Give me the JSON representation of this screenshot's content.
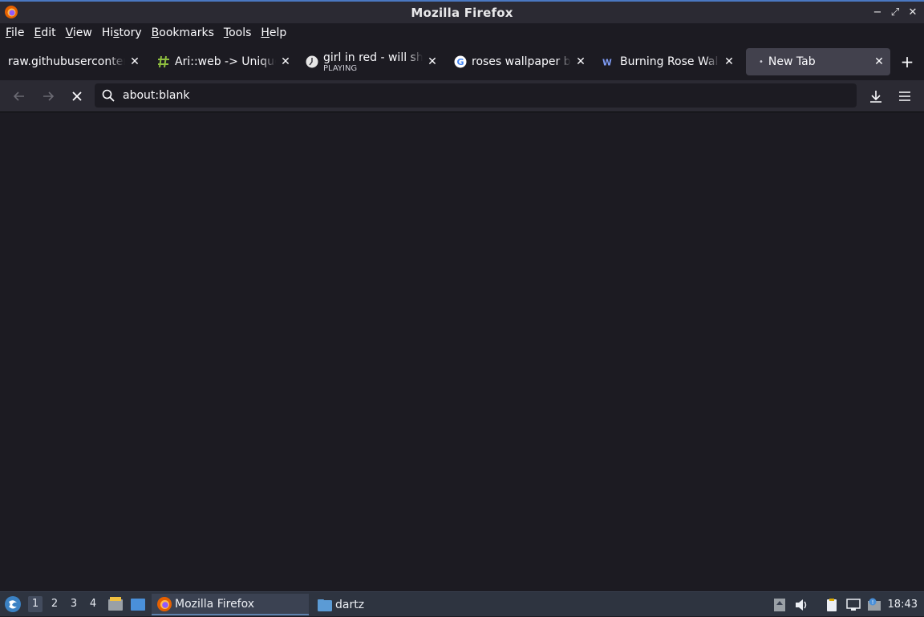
{
  "window": {
    "title": "Mozilla Firefox",
    "controls": {
      "minimize": "−",
      "maximize": "⤢",
      "close": "✕"
    }
  },
  "menubar": {
    "items": [
      {
        "label": "File",
        "accel": "F",
        "rest": "ile"
      },
      {
        "label": "Edit",
        "accel": "E",
        "rest": "dit"
      },
      {
        "label": "View",
        "accel": "V",
        "rest": "iew"
      },
      {
        "label": "History",
        "pre": "Hi",
        "accel": "s",
        "rest": "tory"
      },
      {
        "label": "Bookmarks",
        "accel": "B",
        "rest": "ookmarks"
      },
      {
        "label": "Tools",
        "accel": "T",
        "rest": "ools"
      },
      {
        "label": "Help",
        "accel": "H",
        "rest": "elp"
      }
    ]
  },
  "tabs": [
    {
      "title": "raw.githubusercontent.com",
      "icon": "none",
      "sub": ""
    },
    {
      "title": "Ari::web -> Unique",
      "icon": "hash-icon",
      "sub": ""
    },
    {
      "title": "girl in red - will she",
      "icon": "clock-icon",
      "sub": "PLAYING"
    },
    {
      "title": "roses wallpaper burning",
      "icon": "google-icon",
      "sub": ""
    },
    {
      "title": "Burning Rose Wallpaper",
      "icon": "wallpaper-site-icon",
      "sub": ""
    },
    {
      "title": "New Tab",
      "icon": "dot",
      "sub": "",
      "active": true
    }
  ],
  "newtab_label": "+",
  "navbar": {
    "url": "about:blank",
    "close_glyph": "✕"
  },
  "taskbar": {
    "workspaces": [
      "1",
      "2",
      "3",
      "4"
    ],
    "active_workspace": "1",
    "tasks": [
      {
        "label": "Mozilla Firefox",
        "icon": "firefox-icon",
        "active": true
      },
      {
        "label": "dartz",
        "icon": "folder-icon",
        "active": false
      }
    ],
    "clock": "18:43"
  },
  "colors": {
    "accent": "#4a78c2",
    "tab_active": "#42414d",
    "toolbar": "#2b2a33",
    "content": "#1c1b22"
  }
}
